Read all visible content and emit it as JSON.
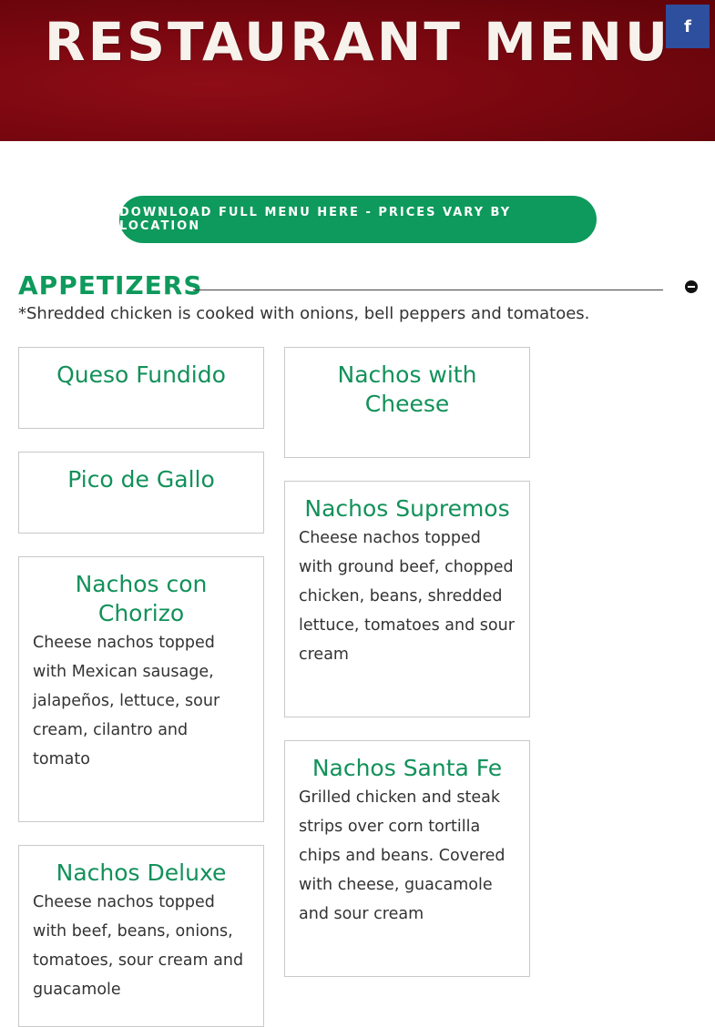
{
  "header": {
    "title": "RESTAURANT MENU",
    "background_color": "#7a0710",
    "facebook_icon": "f"
  },
  "download_button": {
    "label": "DOWNLOAD FULL MENU HERE - PRICES VARY BY LOCATION",
    "color": "#0e9a5c"
  },
  "section": {
    "title": "APPETIZERS",
    "note": "*Shredded chicken is cooked with onions, bell peppers and tomatoes.",
    "accent_color": "#0e9a5c"
  },
  "items": [
    {
      "name": "Queso Fundido",
      "description": ""
    },
    {
      "name": "Nachos with Cheese",
      "description": ""
    },
    {
      "name": "Pico de Gallo",
      "description": ""
    },
    {
      "name": "Nachos Supremos",
      "description": "Cheese nachos topped with ground beef, chopped chicken, beans, shredded lettuce, tomatoes and sour cream"
    },
    {
      "name": "Nachos con Chorizo",
      "description": "Cheese nachos topped with Mexican sausage, jalapeños, lettuce, sour cream, cilantro and tomato"
    },
    {
      "name": "Nachos Santa Fe",
      "description": "Grilled chicken and steak strips over corn tortilla chips and beans. Covered with cheese, guacamole and sour cream"
    },
    {
      "name": "Nachos Deluxe",
      "description": "Cheese nachos topped with beef, beans, onions, tomatoes, sour cream and guacamole"
    }
  ]
}
